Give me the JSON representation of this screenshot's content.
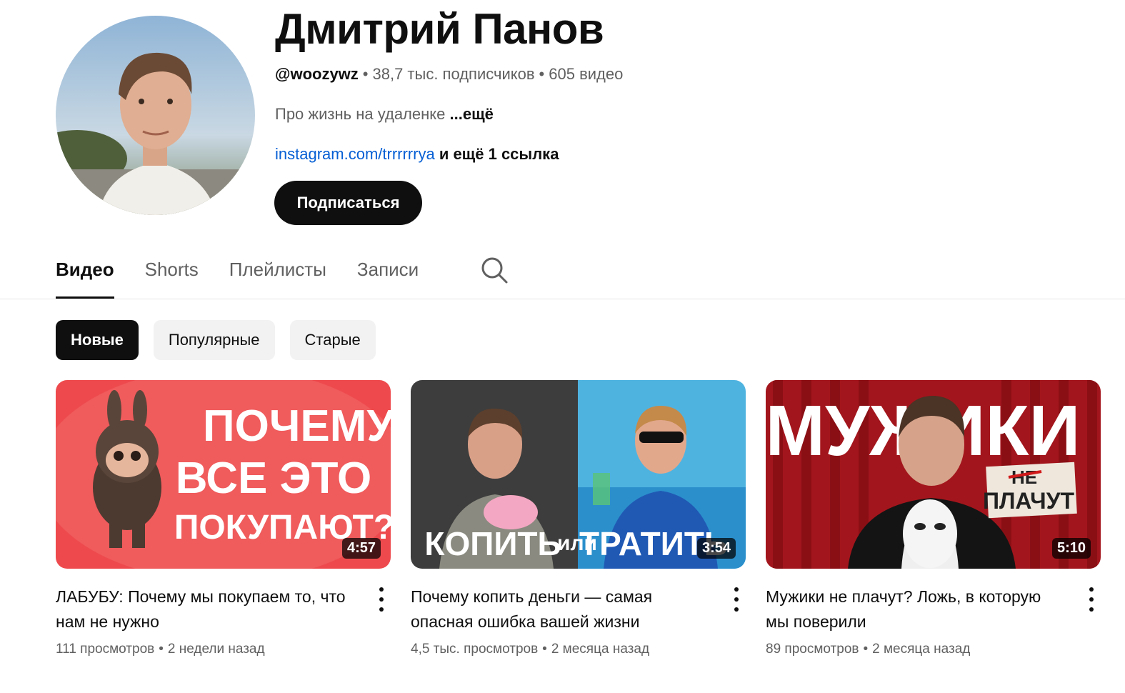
{
  "channel": {
    "name": "Дмитрий Панов",
    "handle": "@woozywz",
    "subscribers": "38,7 тыс. подписчиков",
    "video_count": "605 видео",
    "description": "Про жизнь на удаленке",
    "more_label": "...ещё",
    "link": "instagram.com/trrrrrrya",
    "link_extra": "и ещё 1 ссылка",
    "subscribe_label": "Подписаться"
  },
  "tabs": [
    {
      "label": "Видео",
      "active": true
    },
    {
      "label": "Shorts",
      "active": false
    },
    {
      "label": "Плейлисты",
      "active": false
    },
    {
      "label": "Записи",
      "active": false
    }
  ],
  "icons": {
    "tab_search": "search-icon",
    "more": "more-vert-icon",
    "dot_separator": "•"
  },
  "chips": [
    {
      "label": "Новые",
      "active": true
    },
    {
      "label": "Популярные",
      "active": false
    },
    {
      "label": "Старые",
      "active": false
    }
  ],
  "videos": [
    {
      "title": "ЛАБУБУ: Почему мы покупаем то, что нам не нужно",
      "views": "111 просмотров",
      "age": "2 недели назад",
      "duration": "4:57",
      "thumb_text": [
        "ПОЧЕМУ",
        "ВСЕ ЭТО",
        "ПОКУПАЮТ?"
      ]
    },
    {
      "title": "Почему копить деньги — самая опасная ошибка вашей жизни",
      "views": "4,5 тыс. просмотров",
      "age": "2 месяца назад",
      "duration": "3:54",
      "thumb_text": [
        "КОПИТЬ",
        "или",
        "ТРАТИТЬ"
      ]
    },
    {
      "title": "Мужики не плачут? Ложь, в которую мы поверили",
      "views": "89 просмотров",
      "age": "2 месяца назад",
      "duration": "5:10",
      "thumb_text": [
        "МУЖИКИ",
        "НЕ",
        "ПЛАЧУТ"
      ]
    }
  ],
  "colors": {
    "accent": "#0f0f0f",
    "link": "#065fd4",
    "muted": "#606060",
    "chip_bg": "#f2f2f2"
  }
}
